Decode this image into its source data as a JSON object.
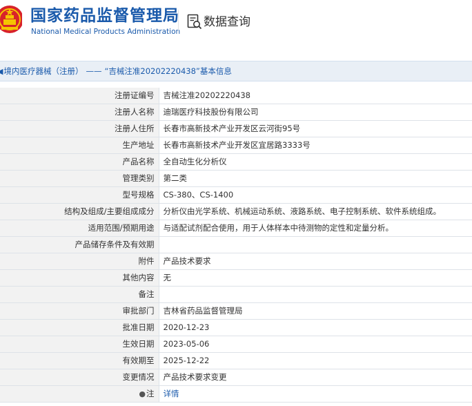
{
  "header": {
    "org_name_cn": "国家药品监督管理局",
    "org_name_en": "National Medical Products Administration",
    "query_label": "数据查询",
    "brand_color": "#1a5aab"
  },
  "breadcrumb": {
    "section": "境内医疗器械（注册）",
    "separator": "——",
    "title": "“吉械注准20202220438”基本信息"
  },
  "record": {
    "rows": [
      {
        "label": "注册证编号",
        "value": "吉械注准20202220438"
      },
      {
        "label": "注册人名称",
        "value": "迪瑞医疗科技股份有限公司"
      },
      {
        "label": "注册人住所",
        "value": "长春市高新技术产业开发区云河街95号"
      },
      {
        "label": "生产地址",
        "value": "长春市高新技术产业开发区宜居路3333号"
      },
      {
        "label": "产品名称",
        "value": "全自动生化分析仪"
      },
      {
        "label": "管理类别",
        "value": "第二类"
      },
      {
        "label": "型号规格",
        "value": "CS-380、CS-1400"
      },
      {
        "label": "结构及组成/主要组成成分",
        "value": "分析仪由光学系统、机械运动系统、液路系统、电子控制系统、软件系统组成。"
      },
      {
        "label": "适用范围/预期用途",
        "value": "与适配试剂配合使用，用于人体样本中待测物的定性和定量分析。"
      },
      {
        "label": "产品储存条件及有效期",
        "value": ""
      },
      {
        "label": "附件",
        "value": "产品技术要求"
      },
      {
        "label": "其他内容",
        "value": "无"
      },
      {
        "label": "备注",
        "value": ""
      },
      {
        "label": "审批部门",
        "value": "吉林省药品监督管理局"
      },
      {
        "label": "批准日期",
        "value": "2020-12-23"
      },
      {
        "label": "生效日期",
        "value": "2023-05-06"
      },
      {
        "label": "有效期至",
        "value": "2025-12-22"
      },
      {
        "label": "变更情况",
        "value": "产品技术要求变更"
      }
    ],
    "note_label": "注",
    "note_link": "详情"
  }
}
